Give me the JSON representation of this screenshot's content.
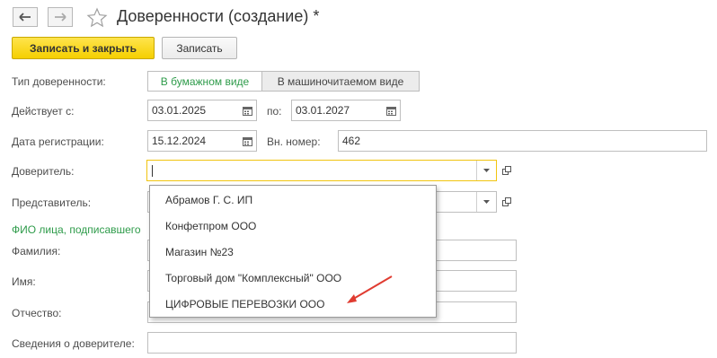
{
  "window": {
    "title": "Доверенности (создание) *"
  },
  "toolbar": {
    "save_close_label": "Записать и закрыть",
    "save_label": "Записать"
  },
  "form": {
    "type_label": "Тип доверенности:",
    "type_options": [
      "В бумажном виде",
      "В машиночитаемом виде"
    ],
    "type_selected": "В бумажном виде",
    "valid_from_label": "Действует с:",
    "valid_from_value": "03.01.2025",
    "valid_to_label": "по:",
    "valid_to_value": "03.01.2027",
    "reg_date_label": "Дата регистрации:",
    "reg_date_value": "15.12.2024",
    "int_number_label": "Вн. номер:",
    "int_number_value": "462",
    "principal_label": "Доверитель:",
    "principal_value": "",
    "representative_label": "Представитель:",
    "signer_section_label": "ФИО лица, подписавшего",
    "last_name_label": "Фамилия:",
    "first_name_label": "Имя:",
    "middle_name_label": "Отчество:",
    "principal_info_label": "Сведения о доверителе:"
  },
  "dropdown": {
    "items": [
      "Абрамов Г. С. ИП",
      "Конфетпром ООО",
      "Магазин №23",
      "Торговый дом \"Комплексный\" ООО",
      "ЦИФРОВЫЕ ПЕРЕВОЗКИ ООО"
    ]
  },
  "colors": {
    "accent_yellow": "#f5cf00",
    "focus_border": "#f1c40f",
    "active_toggle_text": "#2e9b4a",
    "annotation_arrow": "#e03c31"
  },
  "icons": [
    "back-arrow-icon",
    "forward-arrow-icon",
    "star-icon",
    "calendar-icon",
    "dropdown-arrow-icon",
    "open-form-icon"
  ]
}
